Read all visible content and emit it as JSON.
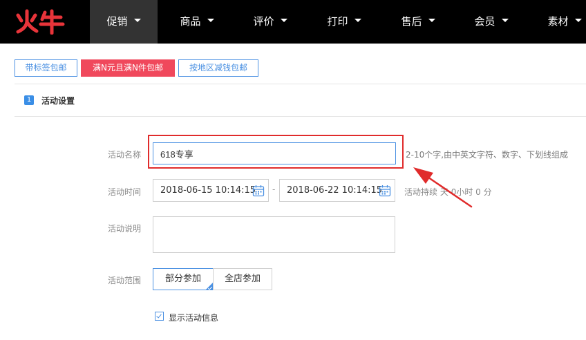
{
  "brand": {
    "logo_text": "火牛",
    "logo_color": "#e8343a"
  },
  "nav": {
    "items": [
      {
        "label": "促销",
        "active": true
      },
      {
        "label": "商品",
        "active": false
      },
      {
        "label": "评价",
        "active": false
      },
      {
        "label": "打印",
        "active": false
      },
      {
        "label": "售后",
        "active": false
      },
      {
        "label": "会员",
        "active": false
      },
      {
        "label": "素材",
        "active": false
      }
    ]
  },
  "modes": [
    {
      "label": "带标签包邮",
      "active": false
    },
    {
      "label": "满N元且满N件包邮",
      "active": true
    },
    {
      "label": "按地区减钱包邮",
      "active": false
    }
  ],
  "section": {
    "step": "1",
    "title": "活动设置"
  },
  "form": {
    "name": {
      "label": "活动名称",
      "value": "618专享",
      "hint": "2-10个字,由中英文字符、数字、下划线组成"
    },
    "time": {
      "label": "活动时间",
      "start": "2018-06-15 10:14:15",
      "separator": "-",
      "end": "2018-06-22 10:14:15",
      "duration_prefix": "活动持续",
      "duration_days_unit": "天",
      "duration_hours": "0",
      "duration_hours_unit": "小时",
      "duration_minutes": "0",
      "duration_minutes_unit": "分"
    },
    "desc": {
      "label": "活动说明",
      "value": ""
    },
    "scope": {
      "label": "活动范围",
      "options": [
        {
          "label": "部分参加",
          "selected": true
        },
        {
          "label": "全店参加",
          "selected": false
        }
      ]
    },
    "show_info": {
      "label": "显示活动信息",
      "checked": true
    }
  },
  "colors": {
    "nav_bg": "#000000",
    "nav_active_bg": "#333333",
    "accent_blue": "#4a90e2",
    "active_tab_red": "#f0485c",
    "annotation_red": "#e02b2b"
  },
  "icons": [
    "calendar-icon",
    "calendar-icon",
    "chevron-down-icon",
    "check-icon"
  ]
}
